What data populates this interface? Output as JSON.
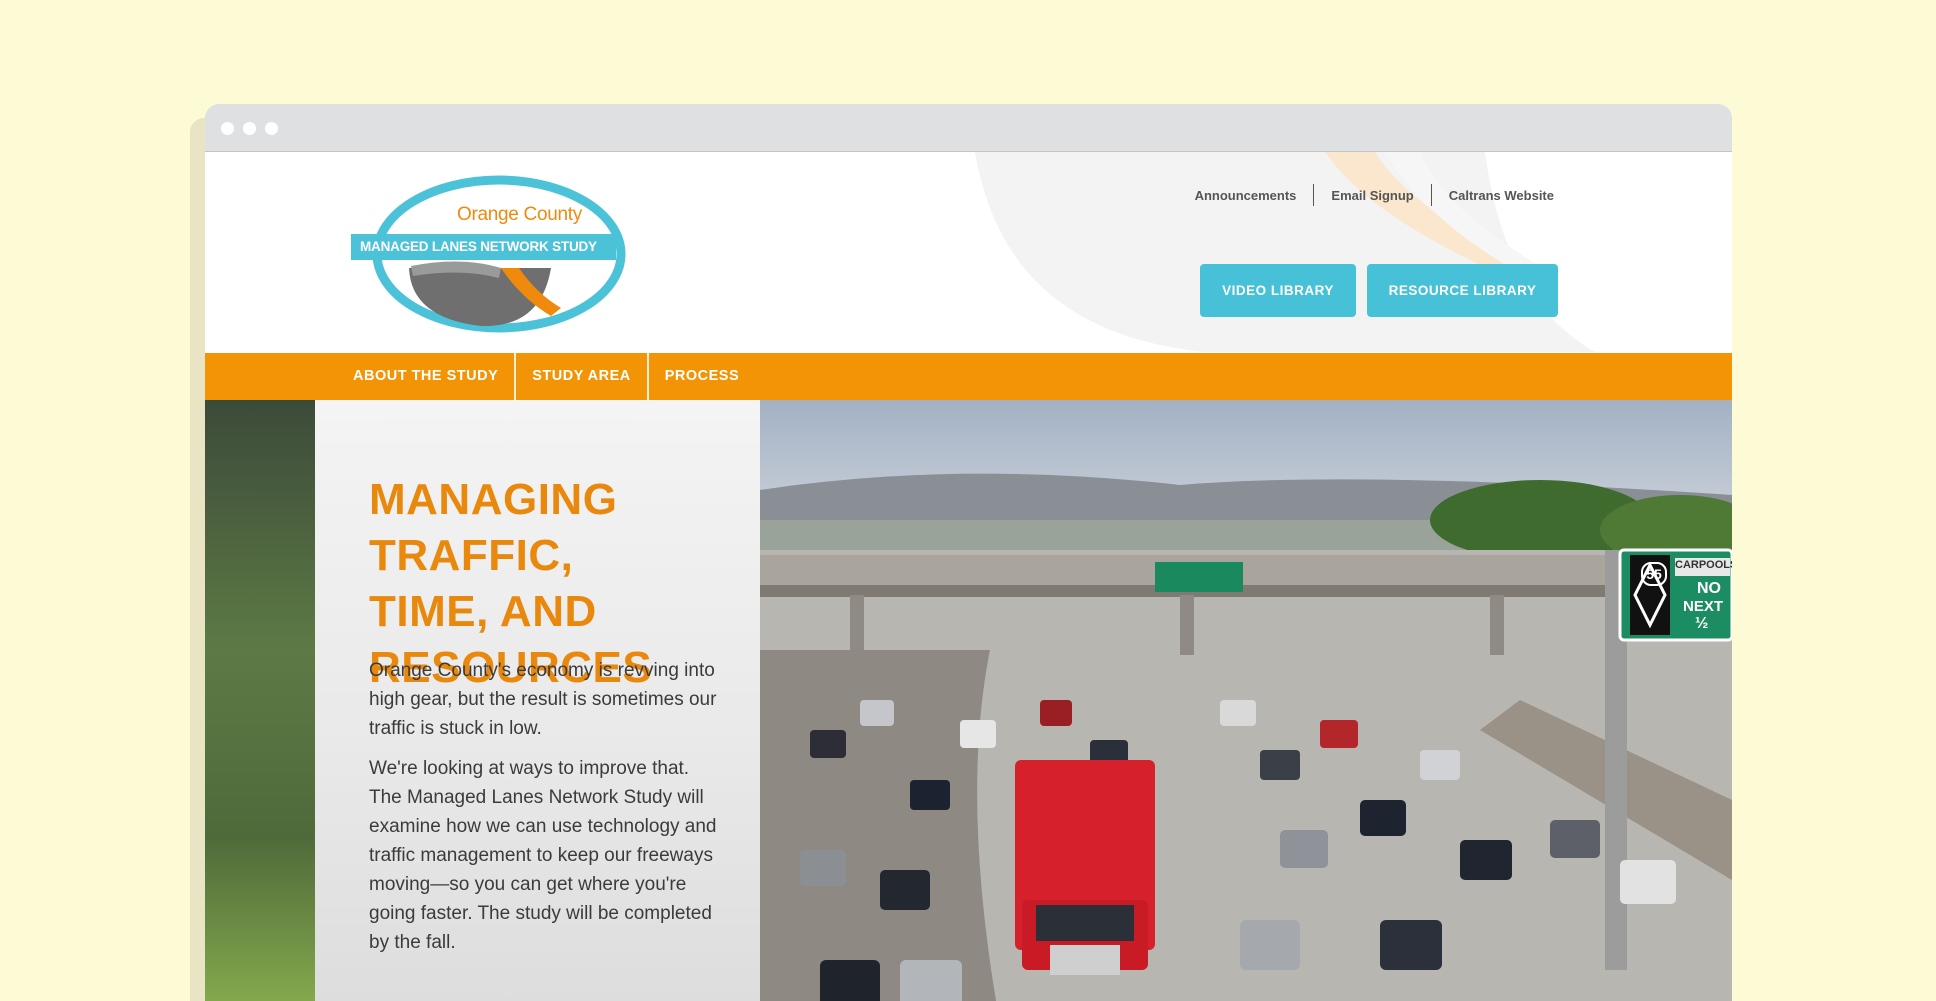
{
  "logo": {
    "top_text": "Orange County",
    "band_text": "MANAGED LANES NETWORK STUDY"
  },
  "utility_links": [
    "Announcements",
    "Email Signup",
    "Caltrans Website"
  ],
  "buttons": {
    "video": "VIDEO LIBRARY",
    "resource": "RESOURCE LIBRARY"
  },
  "nav": [
    "ABOUT THE STUDY",
    "STUDY AREA",
    "PROCESS"
  ],
  "hero": {
    "title_lines": [
      "MANAGING TRAFFIC,",
      "TIME, AND",
      "RESOURCES"
    ],
    "paragraph1": "Orange County's economy is revving into high gear, but the result is sometimes our traffic is stuck in low.",
    "paragraph2": "We're looking at ways to improve that. The Managed Lanes Network Study will examine how we can use technology and traffic management to keep our freeways moving—so you can get where you're going faster. The study will be completed by the fall."
  },
  "signs": {
    "carpools": "CARPOOLS",
    "route": "55",
    "no": "NO",
    "next": "NEXT",
    "half": "½"
  },
  "colors": {
    "background": "#fdfbd6",
    "nav_orange": "#f39406",
    "accent_blue": "#47c1d8",
    "title_orange": "#e8890e"
  }
}
